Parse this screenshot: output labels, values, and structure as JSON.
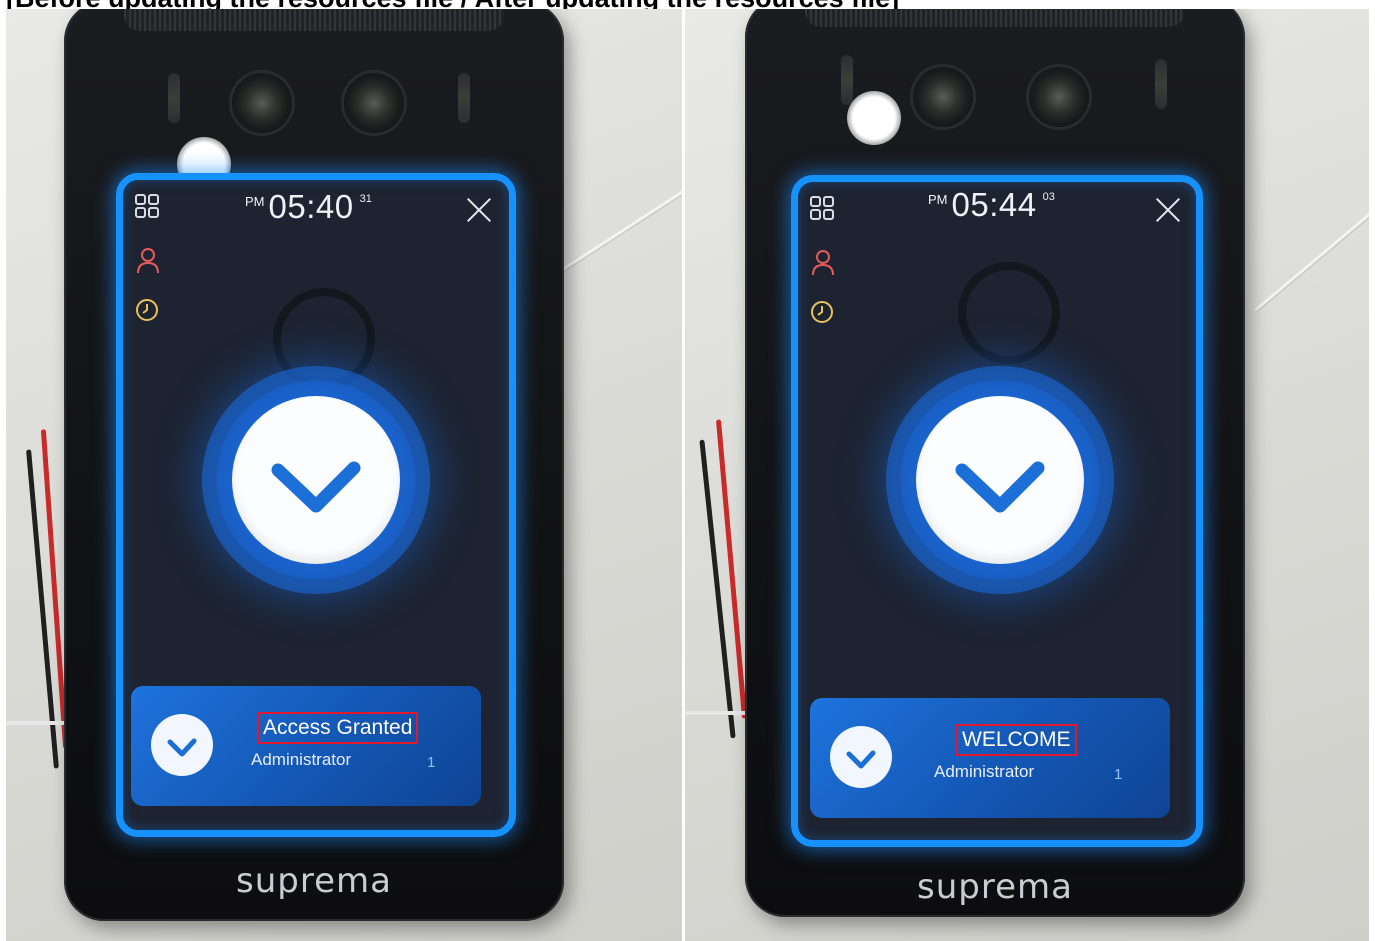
{
  "page": {
    "heading": "[Before updating the resources file / After updating the resources file]"
  },
  "panels": [
    {
      "clock": {
        "ampm": "PM",
        "hm": "05:40",
        "sec": "31"
      },
      "result": {
        "message": "Access Granted",
        "name": "Administrator",
        "id": "1"
      },
      "brand": "suprema"
    },
    {
      "clock": {
        "ampm": "PM",
        "hm": "05:44",
        "sec": "03"
      },
      "result": {
        "message": "WELCOME",
        "name": "Administrator",
        "id": "1"
      },
      "brand": "suprema"
    }
  ],
  "colors": {
    "screen_border": "#1592ff",
    "screen_bg": "#1d2330",
    "check_blue": "#1a63cc",
    "highlight_box": "#e4182c",
    "user_icon": "#e85a5a",
    "clock_icon": "#e8c35a"
  },
  "icons": [
    "menu-grid-icon",
    "user-icon",
    "clock-icon",
    "close-icon",
    "checkmark-icon"
  ]
}
